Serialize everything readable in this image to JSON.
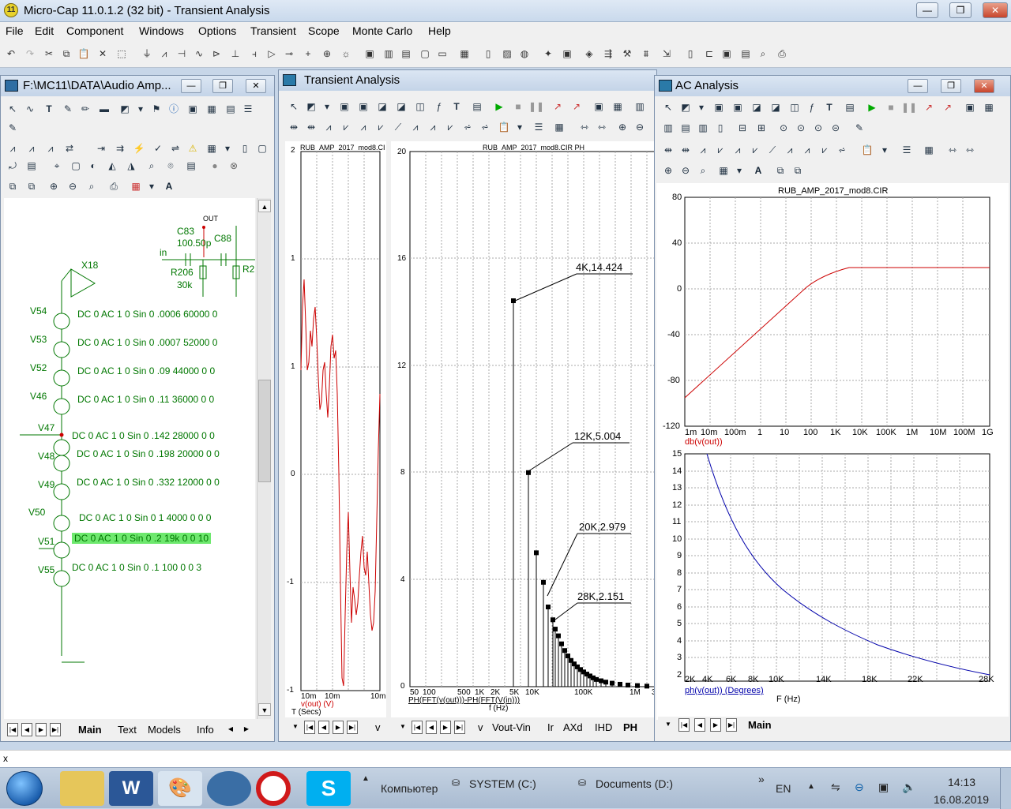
{
  "app": {
    "title": "Micro-Cap 11.0.1.2 (32 bit) - Transient Analysis",
    "icon_text": "11"
  },
  "menu": [
    "File",
    "Edit",
    "Component",
    "Windows",
    "Options",
    "Transient",
    "Scope",
    "Monte Carlo",
    "Help"
  ],
  "schematic": {
    "title": "F:\\MC11\\DATA\\Audio Amp...",
    "labels": {
      "out": "OUT",
      "in": "in",
      "c83": "C83",
      "c88": "C88",
      "cap_val": "100.50p",
      "r206": "R206",
      "r206_val": "30k",
      "r2": "R2",
      "x18": "X18"
    },
    "sources": [
      {
        "name": "V54",
        "value": "DC 0 AC 1 0 Sin 0 .0006 60000 0"
      },
      {
        "name": "V53",
        "value": "DC 0 AC 1 0 Sin 0 .0007 52000 0"
      },
      {
        "name": "V52",
        "value": "DC 0 AC 1 0 Sin 0 .09 44000 0 0"
      },
      {
        "name": "V46",
        "value": "DC 0 AC 1 0 Sin 0 .11 36000 0 0"
      },
      {
        "name": "V47",
        "value": "DC 0 AC 1 0 Sin 0 .142 28000 0 0"
      },
      {
        "name": "V48",
        "value": "DC 0 AC 1 0 Sin 0 .198 20000 0 0"
      },
      {
        "name": "V49",
        "value": "DC 0 AC 1 0 Sin 0 .332 12000 0 0"
      },
      {
        "name": "V50",
        "value": "DC 0 AC 1 0 Sin 0 1 4000 0 0 0"
      },
      {
        "name": "V51",
        "value": "DC 0 AC 1 0 Sin 0 .2 19k 0 0 10"
      },
      {
        "name": "V55",
        "value": "DC 0 AC 1 0 Sin 0 .1 100 0 0 3"
      }
    ],
    "tabs": [
      "Main",
      "Text",
      "Models",
      "Info"
    ]
  },
  "transient": {
    "title": "Transient Analysis",
    "left_plot": {
      "header": "RUB_AMP_2017_mod8.CI",
      "yticks": [
        "2",
        "1",
        "1",
        "0",
        "-1",
        "-1"
      ],
      "xticks": [
        "10m",
        "10m",
        "10m"
      ],
      "ylabel": "v(out) (V)",
      "xlabel": "T (Secs)"
    },
    "right_plot": {
      "header": "RUB_AMP_2017_mod8.CIR PH",
      "yticks": [
        "20",
        "16",
        "12",
        "8",
        "4",
        "0"
      ],
      "xticks": [
        "50",
        "100",
        "500",
        "1K",
        "2K",
        "5K",
        "10K",
        "100K",
        "1M",
        "3"
      ],
      "ylabel": "PH(FFT(v(out)))-PH(FFT(V(in)))",
      "xlabel": "f (Hz)",
      "annotations": [
        "4K,14.424",
        "12K,5.004",
        "20K,2.979",
        "28K,2.151"
      ]
    },
    "tabs": [
      "v",
      "Vout-Vin",
      "Ir",
      "AXd",
      "IHD",
      "PH"
    ]
  },
  "ac": {
    "title": "AC Analysis",
    "top_plot": {
      "header": "RUB_AMP_2017_mod8.CIR",
      "yticks": [
        "80",
        "40",
        "0",
        "-40",
        "-80",
        "-120"
      ],
      "xticks": [
        "1m",
        "10m",
        "100m",
        "1",
        "10",
        "100",
        "1K",
        "10K",
        "100K",
        "1M",
        "10M",
        "100M",
        "1G"
      ],
      "ylabel": "db(v(out))"
    },
    "bottom_plot": {
      "yticks": [
        "15",
        "14",
        "13",
        "12",
        "11",
        "10",
        "9",
        "8",
        "7",
        "6",
        "5",
        "4",
        "3",
        "2"
      ],
      "xticks": [
        "2K",
        "4K",
        "6K",
        "8K",
        "10K",
        "14K",
        "18K",
        "22K",
        "28K"
      ],
      "ylabel": "ph(v(out)) (Degrees)",
      "xlabel": "F (Hz)"
    },
    "tabs": [
      "Main"
    ]
  },
  "status": {
    "text": "x"
  },
  "taskbar": {
    "computer": "Компьютер",
    "drive_c": "SYSTEM (C:)",
    "drive_d": "Documents (D:)",
    "lang": "EN",
    "time": "14:13",
    "date": "16.08.2019"
  }
}
